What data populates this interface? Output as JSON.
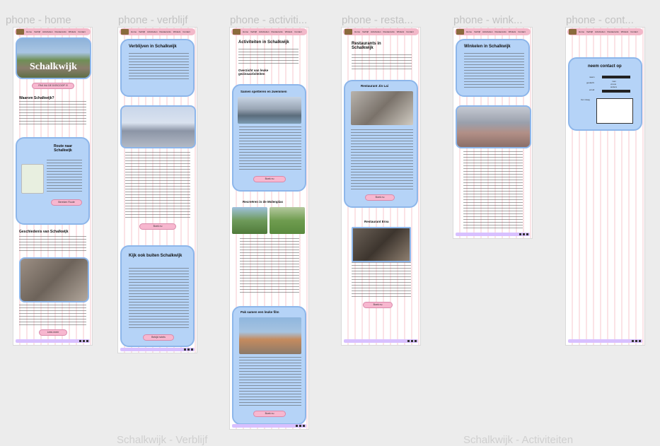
{
  "frames": [
    {
      "title": "phone - home"
    },
    {
      "title": "phone - verblijf"
    },
    {
      "title": "phone - activiti..."
    },
    {
      "title": "phone - resta..."
    },
    {
      "title": "phone - wink..."
    },
    {
      "title": "phone - cont..."
    }
  ],
  "bottom_titles": [
    "Schalkwijk - Verblijf",
    "Schalkwijk - Activiteiten"
  ],
  "nav": [
    "Home",
    "Verblijf",
    "Activiteiten",
    "Restaurants",
    "Winkels",
    "Contact"
  ],
  "home": {
    "hero_title": "Schalkwijk",
    "cta": "PAK NU DE DOSCOOP !!!",
    "q_title": "Waarom Schalkwijk?",
    "route_title": "Route naar Schalkwijk",
    "route_btn": "Bereken Route",
    "hist_title": "Geschiedenis van Schalkwijk",
    "hist_btn": "Lees meer"
  },
  "verblijf": {
    "title": "Verblijven in Schalkwijk",
    "book_btn": "Boek nu",
    "outside_title": "Kijk ook buiten Schalkwijk",
    "hotels_btn": "Bekijk hotels"
  },
  "activiteiten": {
    "title": "Activiteiten in Schalkwijk",
    "sub": "Overzicht van leuke gezinsactiviteiten",
    "swim_title": "Samen spetteren en zwemmen",
    "btn": "Boek nu",
    "molen_title": "Recreëren in de Molenplas",
    "film_title": "Pak samen een leuke film"
  },
  "restaurants": {
    "title": "Restaurants in Schalkwijk",
    "r1": "Restaurant Jin Lai",
    "r2": "Restaurant Erva",
    "btn": "Boek nu"
  },
  "winkels": {
    "title": "Winkelen in Schalkwijk"
  },
  "contact": {
    "title": "neem contact op",
    "naam": "naam",
    "geslacht": "geslacht",
    "email": "email",
    "man": "man",
    "vrouw": "vrouw",
    "anders": "anders",
    "vraag": "Uw vraag"
  }
}
